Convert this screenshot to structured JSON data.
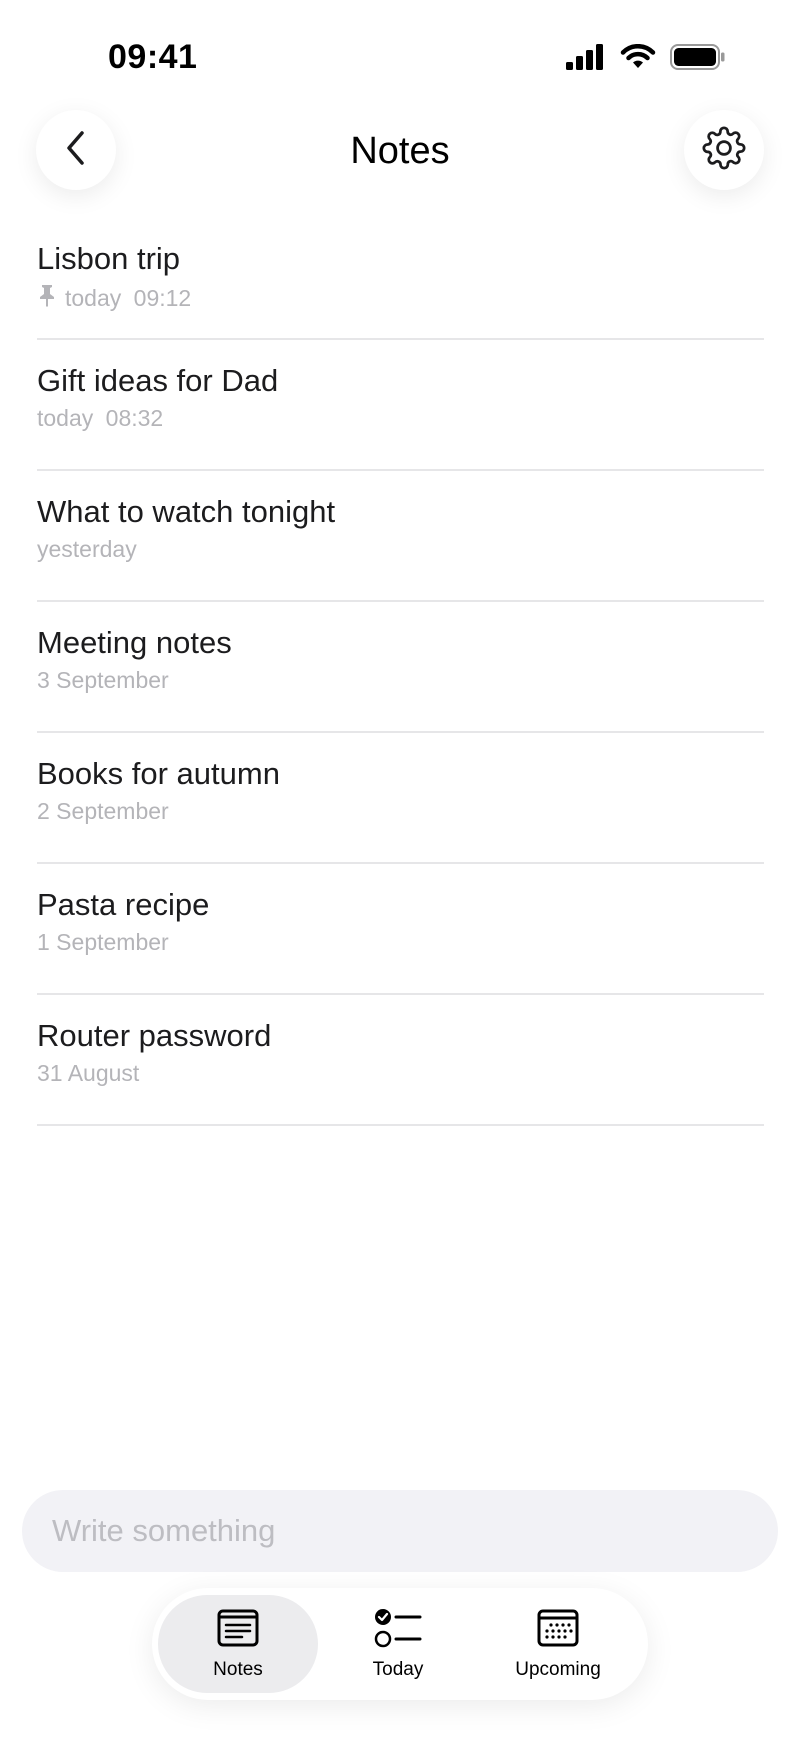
{
  "status": {
    "time": "09:41"
  },
  "header": {
    "title": "Notes"
  },
  "notes": [
    {
      "title": "Lisbon trip",
      "date": "today  09:12",
      "pinned": true
    },
    {
      "title": "Gift ideas for Dad",
      "date": "today  08:32",
      "pinned": false
    },
    {
      "title": "What to watch tonight",
      "date": "yesterday",
      "pinned": false
    },
    {
      "title": "Meeting notes",
      "date": "3 September",
      "pinned": false
    },
    {
      "title": "Books for autumn",
      "date": "2 September",
      "pinned": false
    },
    {
      "title": "Pasta recipe",
      "date": "1 September",
      "pinned": false
    },
    {
      "title": "Router password",
      "date": "31 August",
      "pinned": false
    }
  ],
  "compose": {
    "placeholder": "Write something"
  },
  "tabs": [
    {
      "label": "Notes",
      "icon": "notes-icon",
      "active": true
    },
    {
      "label": "Today",
      "icon": "checklist-icon",
      "active": false
    },
    {
      "label": "Upcoming",
      "icon": "calendar-icon",
      "active": false
    }
  ],
  "colors": {
    "accent": "#000000",
    "muted": "#b4b4b8",
    "divider": "#e6e6e8",
    "active_tab_bg": "#ececee"
  }
}
